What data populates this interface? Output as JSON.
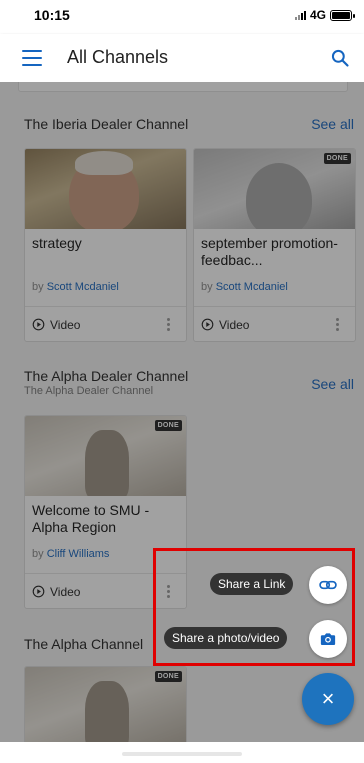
{
  "status_bar": {
    "time": "10:15",
    "network": "4G"
  },
  "app_bar": {
    "title": "All Channels"
  },
  "sections": [
    {
      "title": "The Iberia Dealer Channel",
      "see_all": "See all",
      "cards": [
        {
          "title": "strategy",
          "by": "by",
          "author": "Scott Mcdaniel",
          "media": "Video",
          "badge": ""
        },
        {
          "title": "september promotion- feedbac...",
          "by": "by",
          "author": "Scott Mcdaniel",
          "media": "Video",
          "badge": "DONE"
        }
      ]
    },
    {
      "title": "The Alpha Dealer Channel",
      "subtitle": "The Alpha Dealer Channel",
      "see_all": "See all",
      "cards": [
        {
          "title": "Welcome to SMU - Alpha Region",
          "by": "by",
          "author": "Cliff Williams",
          "media": "Video",
          "badge": "DONE"
        }
      ]
    },
    {
      "title": "The Alpha Channel",
      "cards": [
        {
          "badge": "DONE"
        }
      ]
    }
  ],
  "fab_menu": {
    "share_link": "Share a Link",
    "share_media": "Share a photo/video",
    "close_symbol": "×"
  },
  "colors": {
    "accent": "#1565c0",
    "fab": "#1e73be",
    "highlight": "#e00000"
  }
}
